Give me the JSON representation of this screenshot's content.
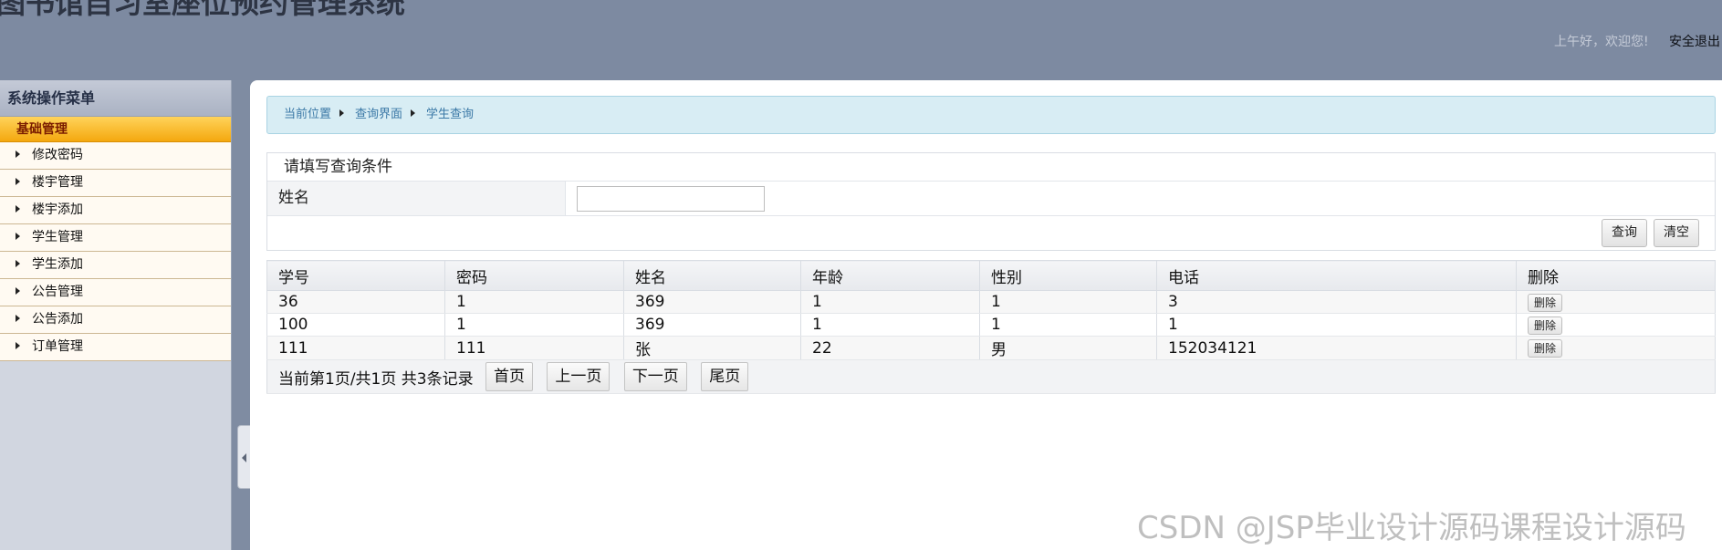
{
  "header": {
    "app_title": "图书馆自习室座位预约管理系统",
    "greeting": "上午好，欢迎您!",
    "logout": "安全退出"
  },
  "sidebar": {
    "title": "系统操作菜单",
    "group": "基础管理",
    "items": [
      {
        "label": "修改密码"
      },
      {
        "label": "楼宇管理"
      },
      {
        "label": "楼宇添加"
      },
      {
        "label": "学生管理"
      },
      {
        "label": "学生添加"
      },
      {
        "label": "公告管理"
      },
      {
        "label": "公告添加"
      },
      {
        "label": "订单管理"
      }
    ]
  },
  "breadcrumb": [
    "当前位置",
    "查询界面",
    "学生查询"
  ],
  "query": {
    "title": "请填写查询条件",
    "field_label": "姓名",
    "field_value": "",
    "search_button": "查询",
    "clear_button": "清空"
  },
  "table": {
    "columns": [
      "学号",
      "密码",
      "姓名",
      "年龄",
      "性别",
      "电话",
      "删除"
    ],
    "rows": [
      [
        "36",
        "1",
        "369",
        "1",
        "1",
        "3"
      ],
      [
        "100",
        "1",
        "369",
        "1",
        "1",
        "1"
      ],
      [
        "111",
        "111",
        "张",
        "22",
        "男",
        "152034121"
      ]
    ],
    "delete_label": "删除"
  },
  "pager": {
    "info": "当前第1页/共1页  共3条记录",
    "first": "首页",
    "prev": "上一页",
    "next": "下一页",
    "last": "尾页"
  },
  "watermark": "CSDN @JSP毕业设计源码课程设计源码"
}
